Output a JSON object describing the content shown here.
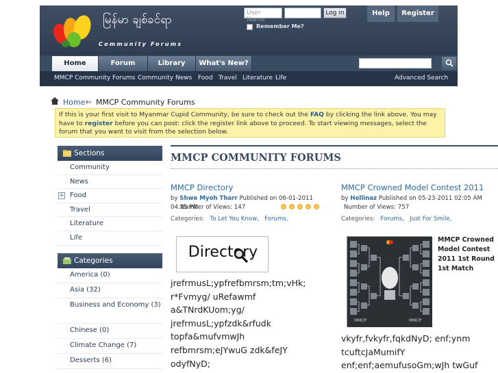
{
  "header": {
    "logo_title": "မြန်မာ ချစ်ခင်ရာ",
    "logo_sub": "Community Forums",
    "login_user_placeholder": "User Name",
    "login_button": "Log in",
    "remember_label": "Remember Me?",
    "help_label": "Help",
    "register_label": "Register"
  },
  "nav": {
    "tabs": [
      {
        "label": "Home"
      },
      {
        "label": "Forum"
      },
      {
        "label": "Library"
      },
      {
        "label": "What's New?"
      }
    ],
    "search_icon": "search-icon"
  },
  "subnav": {
    "items": [
      "MMCP Community Forums",
      "Community",
      "News",
      "Food",
      "Travel",
      "Literature",
      "Life"
    ],
    "advanced_search": "Advanced Search"
  },
  "breadcrumb": {
    "home": "Home",
    "current": "MMCP Community Forums"
  },
  "notice": {
    "part1": "If this is your first visit to Myanmar Cupid Community, be sure to check out the ",
    "faq": "FAQ",
    "part2": " by clicking the link above. You may have to ",
    "register": "register",
    "part3": " before you can post: click the register link above to proceed. To start viewing messages, select the forum that you want to visit from the selection below."
  },
  "sidebar": {
    "sections_title": "Sections",
    "sections": [
      "Community",
      "News",
      "Food",
      "Travel",
      "Literature",
      "Life"
    ],
    "categories_title": "Categories",
    "categories": [
      "America (0)",
      "Asia (32)",
      "Business and Economy (3)",
      "Chinese (0)",
      "Climate Change (7)",
      "Desserts (6)"
    ]
  },
  "main": {
    "title": "MMCP COMMUNITY FORUMS",
    "article1": {
      "title": "MMCP Directory",
      "by": "by ",
      "author": "Shwe Myoh Tharr",
      "published": " Published on 06-01-2011 04:25 PM",
      "views": "Number of Views: 147",
      "rating": 5,
      "cats_label": "Categories:",
      "cat1": "To Let You Know,",
      "cat2": "Forums,",
      "image_text": "Directory",
      "body": "jrefrmusL;ypfrefbmrsm;tm;vHk; r*Fvmyg/ uRefawmf a&TNrdKUom;yg/ jrefrmusL;ypfzdk&rfudk topfa&mufvmwJh refbmrsm;eJYwuG zdk&feJY odyfNyD;"
    },
    "article2": {
      "title": "MMCP Crowned Model Contest 2011",
      "by": "by ",
      "author": "Hollinaz",
      "published": " Published on 05-23-2011 02:05 AM",
      "views": "Number of Views: 757",
      "cats_label": "Categories:",
      "cat1": "Forums,",
      "cat2": "Just For Smile,",
      "image_caption": "MMCP Crowned Model Contest 2011 1st Round 1st Match",
      "body": "vkyfr,fvkyfr,fqkdNyD; enf;ynm tcuftcJaMumifY enf;enf;aemufusoGm;wJh twGuf"
    }
  },
  "colors": {
    "header_bg": "#3a4a60",
    "link": "#2a6aa0",
    "notice_bg": "#fdf3a8"
  }
}
